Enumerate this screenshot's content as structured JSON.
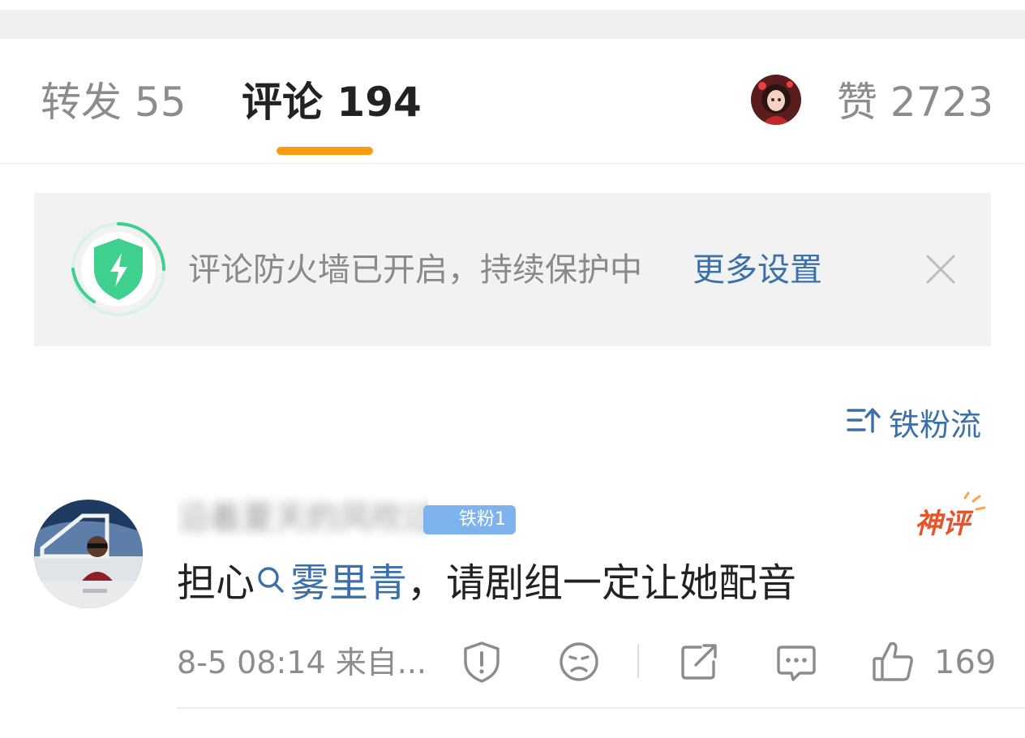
{
  "tabs": {
    "repost_label": "转发 55",
    "comment_label": "评论 194",
    "likes_label": "赞 2723"
  },
  "banner": {
    "text": "评论防火墙已开启，持续保护中",
    "link": "更多设置"
  },
  "sort": {
    "label": "铁粉流"
  },
  "comment": {
    "username": "沿着夏天的风吹过来",
    "fan_badge": "铁粉1",
    "hot_tag": "神评",
    "text_before": "担心",
    "topic": "雾里青",
    "text_after": "，请剧组一定让她配音",
    "meta": "8-5 08:14  来自...",
    "like_count": "169"
  },
  "colors": {
    "accent_orange": "#ff9b0f",
    "link_blue": "#3d6fa8",
    "shield_green": "#3fcf8e",
    "hot_red": "#e8532a"
  }
}
